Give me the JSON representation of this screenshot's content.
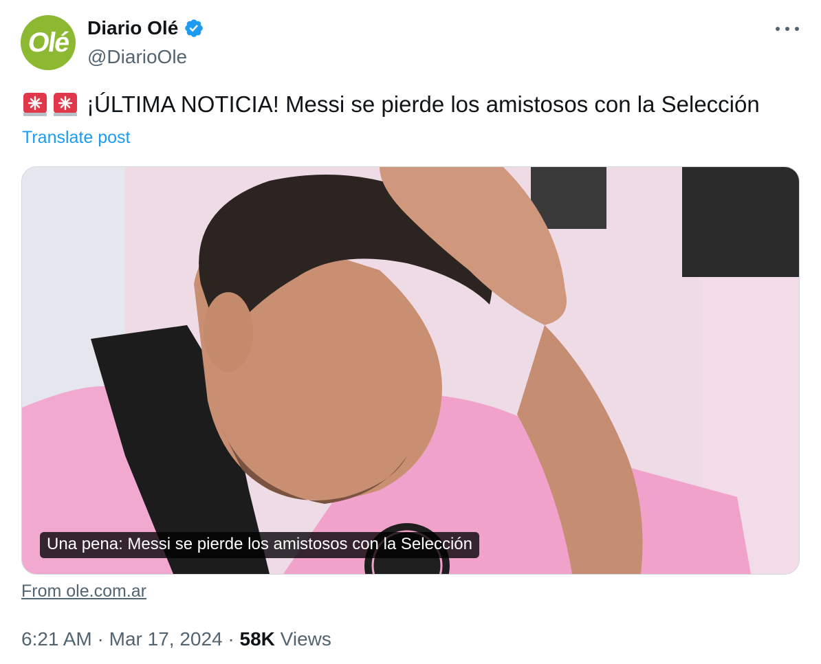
{
  "author": {
    "display_name": "Diario Olé",
    "handle": "@DiarioOle",
    "avatar_text": "Olé",
    "verified": true,
    "avatar_color": "#8cb832",
    "verified_color": "#1d9bf0"
  },
  "menu": {
    "icon": "more-horizontal-icon"
  },
  "post": {
    "text": "¡ÚLTIMA NOTICIA! Messi se pierde los amistosos con la Selección",
    "emoji_icons": [
      "siren-icon",
      "siren-icon"
    ],
    "translate_label": "Translate post"
  },
  "card": {
    "caption": "Una pena: Messi se pierde los amistosos con la Selección",
    "source": "From ole.com.ar"
  },
  "meta": {
    "time": "6:21 AM",
    "date": "Mar 17, 2024",
    "views_count": "58K",
    "views_label": "Views",
    "separator": "·"
  }
}
